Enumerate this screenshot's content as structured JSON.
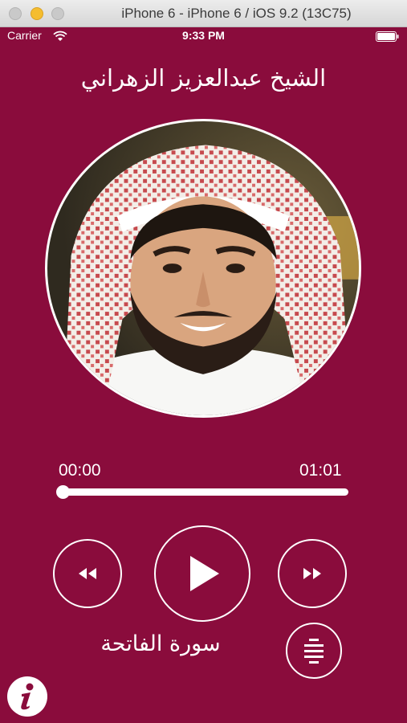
{
  "window": {
    "title": "iPhone 6 - iPhone 6 / iOS 9.2 (13C75)"
  },
  "status_bar": {
    "carrier": "Carrier",
    "time": "9:33 PM",
    "icons": [
      "wifi-icon",
      "battery-icon"
    ]
  },
  "player": {
    "reciter": "الشيخ عبدالعزيز الزهراني",
    "elapsed": "00:00",
    "duration": "01:01",
    "progress": 0.0,
    "surah": "سورة الفاتحة",
    "controls": [
      "rewind-icon",
      "play-icon",
      "fast-forward-icon",
      "list-icon",
      "info-icon"
    ]
  },
  "colors": {
    "background": "#8a0c3c",
    "foreground": "#ffffff"
  }
}
